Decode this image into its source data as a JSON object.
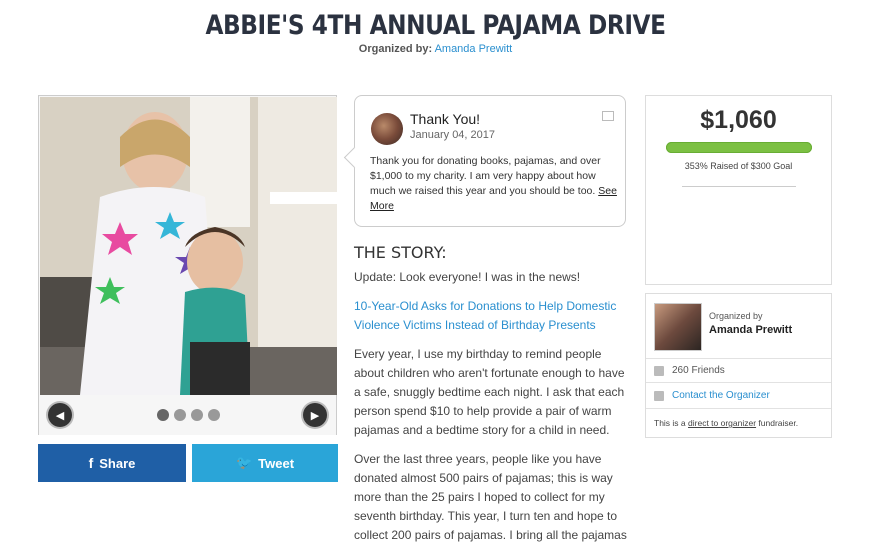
{
  "page": {
    "title": "ABBIE'S 4TH ANNUAL PAJAMA DRIVE",
    "organized_by_label": "Organized by:",
    "organizer_name": "Amanda Prewitt"
  },
  "carousel": {
    "prev_icon": "chevron-left-icon",
    "next_icon": "chevron-right-icon",
    "slide_count": 4,
    "active_index": 0
  },
  "share": {
    "facebook_label": "Share",
    "twitter_label": "Tweet",
    "facebook_icon_glyph": "f",
    "twitter_icon_glyph": "🐦",
    "facebook_color": "#1f5fa6",
    "twitter_color": "#2aa5d8"
  },
  "update": {
    "title": "Thank You!",
    "date": "January 04, 2017",
    "body": "Thank you for donating books, pajamas, and over $1,000 to my charity. I am very happy about how much we raised this year and you should be too.",
    "see_more": "See More"
  },
  "story": {
    "heading": "THE STORY:",
    "paragraphs": [
      "Update: Look everyone! I was in the news!",
      "10-Year-Old Asks for Donations to Help Domestic Violence Victims Instead of Birthday Presents",
      "Every year, I use my birthday to remind people about children who aren't fortunate enough to have a safe, snuggly bedtime each night. I ask that each person spend $10 to help provide a pair of warm pajamas and a bedtime story for a child in need.",
      "Over the last three years, people like you have donated almost 500 pairs of pajamas; this is way more than the 25 pairs I hoped to collect for my seventh birthday. This year, I turn ten and hope to collect 200 pairs of pajamas. I bring all the pajamas"
    ]
  },
  "fundraiser": {
    "amount": "$1,060",
    "raised_text": "353% Raised of $300 Goal",
    "progress_percent": 100,
    "progress_color": "#7cc043"
  },
  "organizer": {
    "label": "Organized by",
    "name": "Amanda Prewitt",
    "friends": "260 Friends",
    "contact": "Contact the Organizer",
    "note_prefix": "This is a ",
    "note_highlight": "direct to organizer",
    "note_suffix": " fundraiser."
  },
  "colors": {
    "link": "#2a8fcf",
    "title": "#2b3240"
  }
}
